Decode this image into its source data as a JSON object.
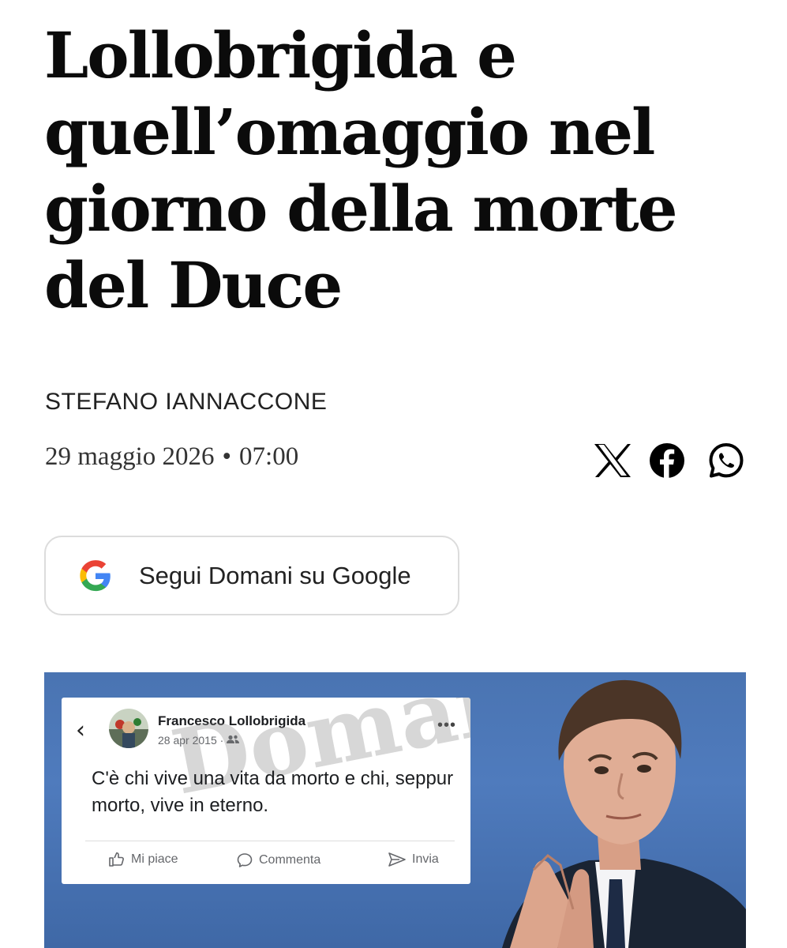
{
  "article": {
    "headline": "Lollobrigida e quell’omaggio nel giorno della morte del Duce",
    "author": "STEFANO IANNACCONE",
    "date": "29 maggio 2026",
    "separator": "•",
    "time": "07:00"
  },
  "share": {
    "icons": [
      "x-icon",
      "facebook-icon",
      "whatsapp-icon"
    ]
  },
  "follow_button": {
    "label": "Segui Domani su Google",
    "icon": "google-icon"
  },
  "hero_image": {
    "facebook_post": {
      "author": "Francesco Lollobrigida",
      "date": "28 apr 2015 ·",
      "text": "C'è chi vive una vita da morto e chi, seppur morto, vive in eterno.",
      "more": "•••",
      "actions": {
        "like": "Mi piace",
        "comment": "Commenta",
        "send": "Invia"
      }
    },
    "watermark": "Domani"
  },
  "colors": {
    "hero_background": "#4a74b2",
    "text": "#0b0b0b"
  }
}
